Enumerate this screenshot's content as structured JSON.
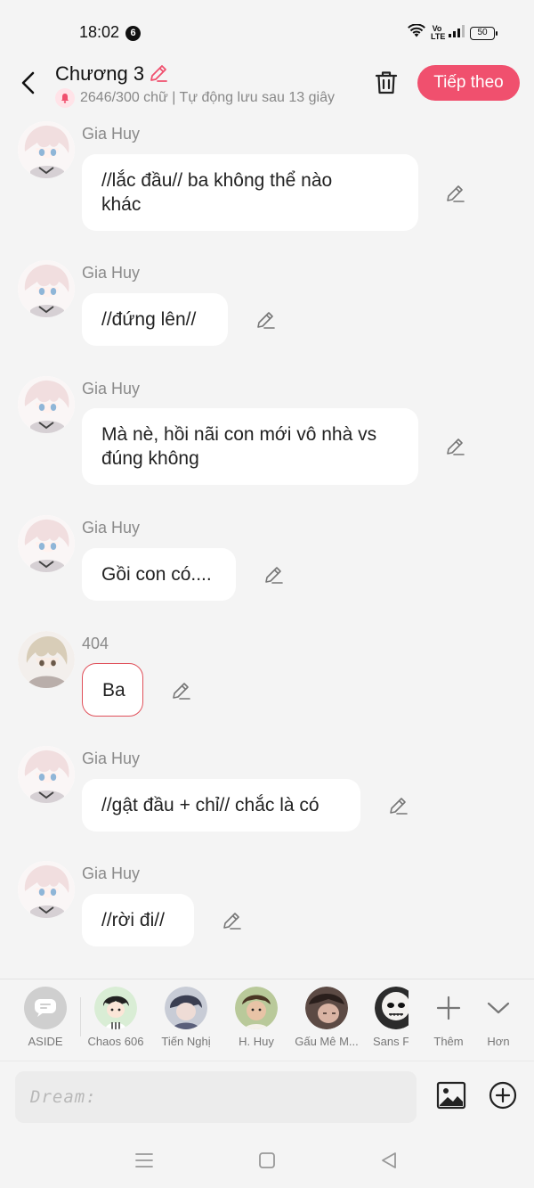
{
  "status_bar": {
    "time": "18:02",
    "notification_count": "6",
    "volte": "Vo\nLTE",
    "battery": "50"
  },
  "header": {
    "title": "Chương 3",
    "subtitle": "2646/300 chữ | Tự động lưu sau 13 giây",
    "next_label": "Tiếp theo",
    "accent_color": "#f0506e"
  },
  "messages": [
    {
      "sender": "Gia Huy",
      "text": "//lắc đầu// ba không thể nào\nkhác",
      "avatar": "anime-white-hair"
    },
    {
      "sender": "Gia Huy",
      "text": "//đứng lên//",
      "avatar": "anime-white-hair"
    },
    {
      "sender": "Gia Huy",
      "text": "Mà nè, hồi nãi con mới vô nhà vs\nđúng không",
      "avatar": "anime-white-hair"
    },
    {
      "sender": "Gia Huy",
      "text": "Gồi con có....",
      "avatar": "anime-white-hair"
    },
    {
      "sender": "404",
      "text": "Ba",
      "avatar": "anime-beige-hair",
      "selected": true
    },
    {
      "sender": "Gia Huy",
      "text": "//gật đầu + chỉ// chắc là có",
      "avatar": "anime-white-hair"
    },
    {
      "sender": "Gia Huy",
      "text": "//rời đi//",
      "avatar": "anime-white-hair"
    }
  ],
  "characters": [
    {
      "name": "ASIDE",
      "icon": "chat-bubble-icon"
    },
    {
      "name": "Chaos 606"
    },
    {
      "name": "Tiến Nghị"
    },
    {
      "name": "H. Huy"
    },
    {
      "name": "Gấu Mê M..."
    },
    {
      "name": "Sans F"
    }
  ],
  "more_label": "Thêm",
  "collapse_label": "Hơn",
  "input": {
    "placeholder": "Dream:"
  }
}
